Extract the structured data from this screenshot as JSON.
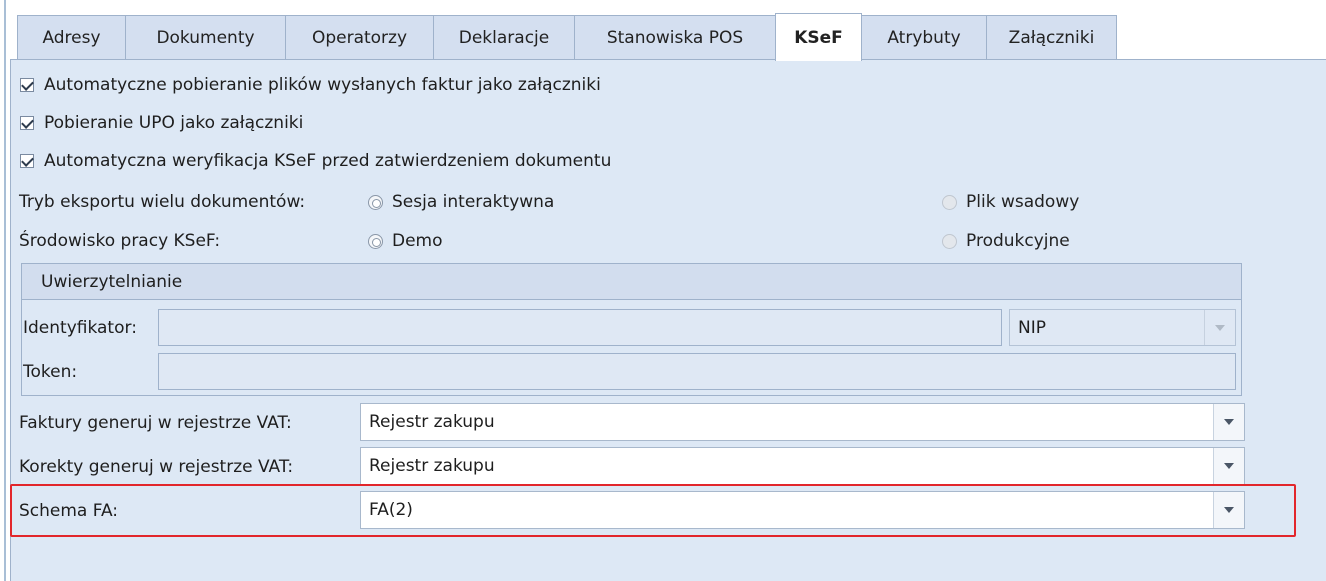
{
  "tabs": [
    {
      "label": "Adresy",
      "active": false
    },
    {
      "label": "Dokumenty",
      "active": false
    },
    {
      "label": "Operatorzy",
      "active": false
    },
    {
      "label": "Deklaracje",
      "active": false
    },
    {
      "label": "Stanowiska POS",
      "active": false
    },
    {
      "label": "KSeF",
      "active": true
    },
    {
      "label": "Atrybuty",
      "active": false
    },
    {
      "label": "Załączniki",
      "active": false
    }
  ],
  "checkboxes": [
    {
      "label": "Automatyczne pobieranie plików wysłanych faktur jako załączniki",
      "checked": true
    },
    {
      "label": "Pobieranie UPO jako załączniki",
      "checked": true
    },
    {
      "label": "Automatyczna weryfikacja KSeF przed zatwierdzeniem dokumentu",
      "checked": true
    }
  ],
  "export_mode": {
    "label": "Tryb eksportu wielu dokumentów:",
    "options": [
      {
        "label": "Sesja interaktywna",
        "selected": true,
        "enabled": true
      },
      {
        "label": "Plik wsadowy",
        "selected": false,
        "enabled": false
      }
    ]
  },
  "environment": {
    "label": "Środowisko pracy KSeF:",
    "options": [
      {
        "label": "Demo",
        "selected": true,
        "enabled": true
      },
      {
        "label": "Produkcyjne",
        "selected": false,
        "enabled": false
      }
    ]
  },
  "auth": {
    "title": "Uwierzytelnianie",
    "identifier_label": "Identyfikator:",
    "identifier_value": "",
    "identifier_type": "NIP",
    "token_label": "Token:",
    "token_value": ""
  },
  "invoices_register": {
    "label": "Faktury generuj w rejestrze VAT:",
    "value": "Rejestr zakupu"
  },
  "corrections_register": {
    "label": "Korekty generuj w rejestrze VAT:",
    "value": "Rejestr zakupu"
  },
  "schema": {
    "label": "Schema FA:",
    "value": "FA(2)"
  },
  "colors": {
    "highlight": "#e2262b",
    "panel": "#dde8f5",
    "tab": "#d4dff0"
  }
}
